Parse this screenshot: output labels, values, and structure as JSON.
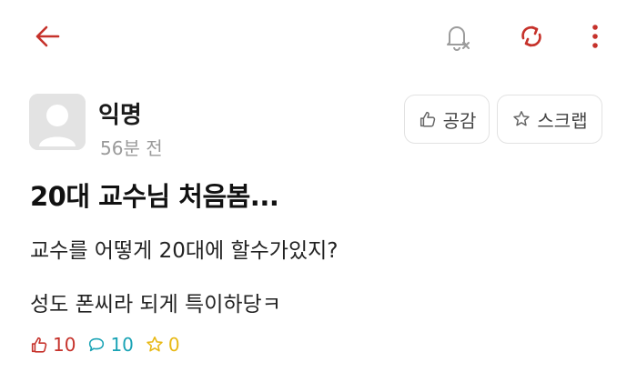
{
  "header": {
    "back_icon": "arrow-left-icon",
    "notification_icon": "bell-off-icon",
    "refresh_icon": "refresh-icon",
    "more_icon": "more-vertical-icon",
    "accent_color": "#c6322b"
  },
  "post": {
    "author": "익명",
    "time": "56분 전",
    "like_button_label": "공감",
    "scrap_button_label": "스크랩",
    "title": "20대 교수님 처음봄...",
    "body_lines": [
      "교수를 어떻게 20대에 할수가있지?",
      "성도 폰씨라 되게 특이하당ㅋ"
    ]
  },
  "stats": {
    "likes": "10",
    "comments": "10",
    "scraps": "0",
    "like_color": "#c6322b",
    "comment_color": "#1aa3b5",
    "scrap_color": "#e8b916"
  }
}
